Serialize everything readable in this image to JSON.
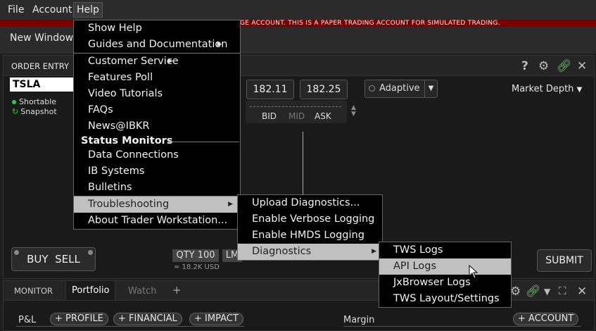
{
  "menubar": {
    "items": [
      "File",
      "Account",
      "Help"
    ]
  },
  "banner": {
    "text": "GE ACCOUNT. THIS IS A PAPER TRADING ACCOUNT FOR SIMULATED TRADING."
  },
  "topbar": {
    "new_window": "New Window"
  },
  "order_entry": {
    "title": "ORDER ENTRY",
    "symbol": "TSLA",
    "tags": [
      "Shortable",
      "Snapshot"
    ],
    "bid": "182.11",
    "ask": "182.25",
    "labels": {
      "bid": "BID",
      "mid": "MID",
      "ask": "ASK"
    },
    "algo": "Adaptive",
    "market_depth": "Market Depth",
    "buy": "BUY",
    "sell": "SELL",
    "qty": "QTY 100",
    "order_type": "LM",
    "usd": "≈ 18.2K USD",
    "submit": "SUBMIT",
    "help_icon": "?"
  },
  "monitor": {
    "tabs": [
      "MONITOR",
      "Portfolio",
      "Watch",
      "+"
    ],
    "pnl": "P&L",
    "buttons": [
      "+ PROFILE",
      "+ FINANCIAL",
      "+ IMPACT"
    ],
    "margin": "Margin",
    "account": "+ ACCOUNT"
  },
  "help_menu": {
    "items": [
      {
        "label": "Show Help"
      },
      {
        "label": "Guides and Documentation"
      },
      {
        "label": "Customer Service"
      },
      {
        "label": "Features Poll"
      },
      {
        "label": "Video Tutorials"
      },
      {
        "label": "FAQs"
      },
      {
        "label": "News@IBKR"
      },
      {
        "label": "Status Monitors"
      },
      {
        "label": "Data Connections"
      },
      {
        "label": "IB Systems"
      },
      {
        "label": "Bulletins"
      },
      {
        "label": "Troubleshooting"
      },
      {
        "label": "About Trader Workstation..."
      }
    ]
  },
  "troubleshooting_menu": {
    "items": [
      {
        "label": "Upload Diagnostics..."
      },
      {
        "label": "Enable Verbose Logging"
      },
      {
        "label": "Enable HMDS Logging"
      },
      {
        "label": "Diagnostics"
      }
    ]
  },
  "diagnostics_menu": {
    "items": [
      {
        "label": "TWS Logs"
      },
      {
        "label": "API Logs"
      },
      {
        "label": "JxBrowser Logs"
      },
      {
        "label": "TWS Layout/Settings"
      }
    ]
  },
  "colors": {
    "banner": "#7a0000",
    "highlight": "#c0c0c0",
    "green_dot": "#2ecc40"
  }
}
